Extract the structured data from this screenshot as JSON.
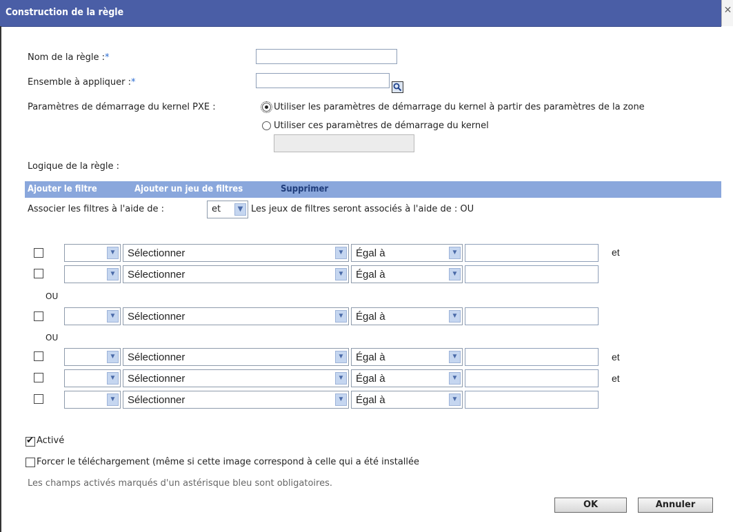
{
  "window": {
    "title": "Construction de la règle",
    "close_icon": "close-icon"
  },
  "form": {
    "rule_name_label": "Nom de la règle :",
    "rule_name_req": "*",
    "rule_name_value": "",
    "set_label": "Ensemble à appliquer :",
    "set_req": "*",
    "set_value": "",
    "kernel_label": "Paramètres de démarrage du kernel PXE :",
    "kernel_opt1": "Utiliser les paramètres de démarrage du kernel à partir des paramètres de la zone",
    "kernel_opt2": "Utiliser ces paramètres de démarrage du kernel",
    "kernel_params_value": "",
    "kernel_selected": 1
  },
  "logic": {
    "label": "Logique de la règle :",
    "toolbar": [
      "Ajouter le filtre",
      "Ajouter un jeu de filtres",
      "Supprimer"
    ],
    "associate_label": "Associer les filtres à l'aide de :",
    "associate_value": "et",
    "sets_note": "Les jeux de filtres seront associés à l'aide de : OU",
    "or_label": "OU",
    "and_label": "et",
    "rows": [
      {
        "prefix": "",
        "field": "Sélectionner",
        "operator": "Égal à",
        "value": "",
        "suffix": "et"
      },
      {
        "prefix": "",
        "field": "Sélectionner",
        "operator": "Égal à",
        "value": "",
        "suffix": ""
      },
      {
        "prefix": "",
        "field": "Sélectionner",
        "operator": "Égal à",
        "value": "",
        "suffix": ""
      },
      {
        "prefix": "",
        "field": "Sélectionner",
        "operator": "Égal à",
        "value": "",
        "suffix": "et"
      },
      {
        "prefix": "",
        "field": "Sélectionner",
        "operator": "Égal à",
        "value": "",
        "suffix": "et"
      },
      {
        "prefix": "",
        "field": "Sélectionner",
        "operator": "Égal à",
        "value": "",
        "suffix": ""
      }
    ]
  },
  "options": {
    "enabled_label": "Activé",
    "enabled": true,
    "force_label": "Forcer le téléchargement (même si cette image correspond à celle qui a été installée",
    "force": false
  },
  "footer": {
    "note": "Les champs activés marqués d'un astérisque bleu sont obligatoires.",
    "ok": "OK",
    "cancel": "Annuler"
  }
}
